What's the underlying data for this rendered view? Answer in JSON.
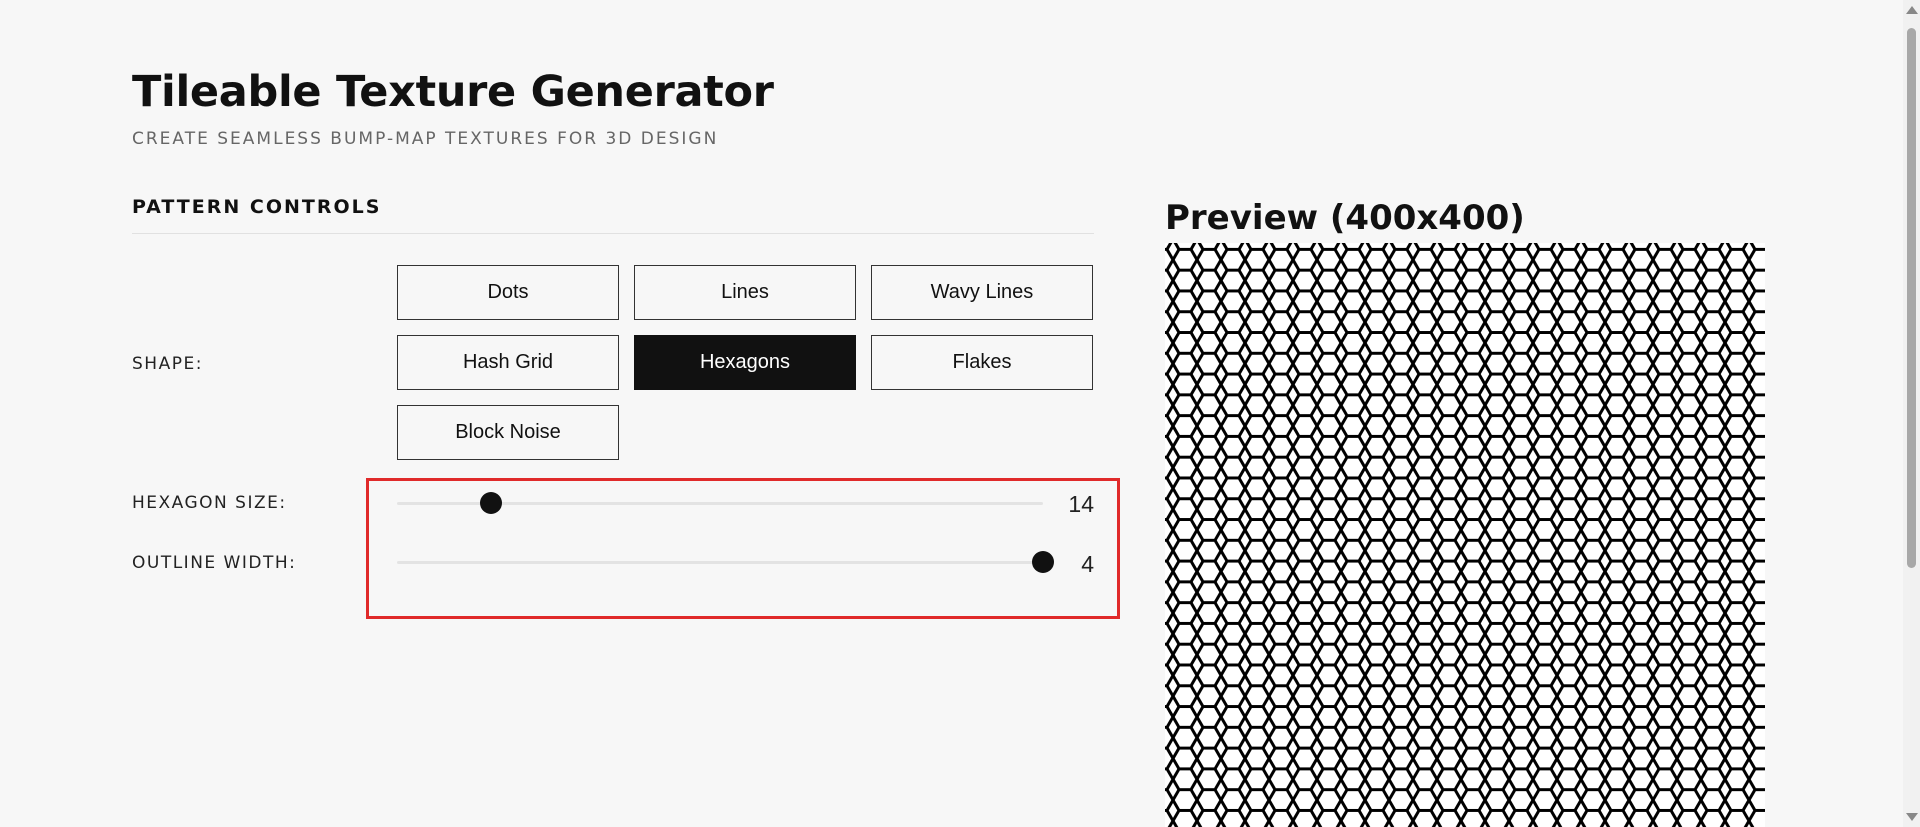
{
  "header": {
    "title": "Tileable Texture Generator",
    "subtitle": "CREATE SEAMLESS BUMP-MAP TEXTURES FOR 3D DESIGN"
  },
  "controls": {
    "heading": "PATTERN CONTROLS",
    "shape_label": "SHAPE:",
    "shapes": [
      {
        "label": "Dots",
        "active": false
      },
      {
        "label": "Lines",
        "active": false
      },
      {
        "label": "Wavy Lines",
        "active": false
      },
      {
        "label": "Hash Grid",
        "active": false
      },
      {
        "label": "Hexagons",
        "active": true
      },
      {
        "label": "Flakes",
        "active": false
      },
      {
        "label": "Block Noise",
        "active": false
      }
    ],
    "sliders": [
      {
        "label": "HEXAGON SIZE:",
        "value": "14",
        "fraction": 0.145
      },
      {
        "label": "OUTLINE WIDTH:",
        "value": "4",
        "fraction": 1.0
      }
    ]
  },
  "preview": {
    "title": "Preview (400x400)"
  },
  "colors": {
    "accent": "#111111",
    "highlight": "#e02a2a",
    "background": "#f7f7f7"
  }
}
